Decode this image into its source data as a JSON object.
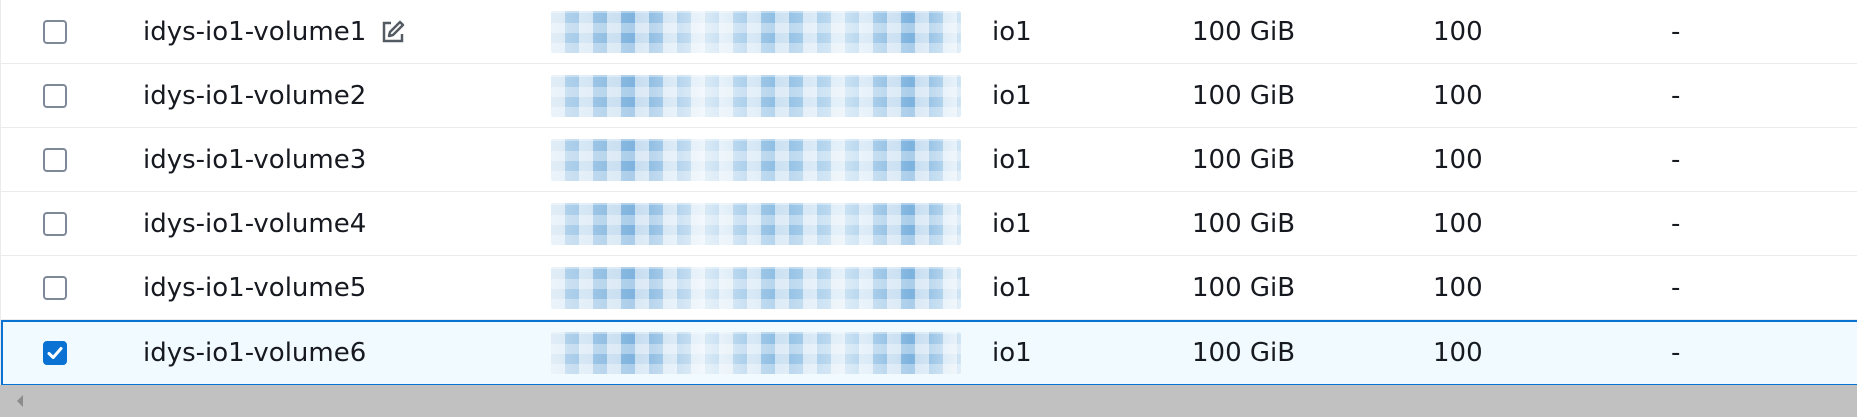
{
  "columns_hidden": true,
  "rows": [
    {
      "name": "idys-io1-volume1",
      "type": "io1",
      "size": "100 GiB",
      "iops": "100",
      "throughput": "-",
      "checked": false,
      "editable": true
    },
    {
      "name": "idys-io1-volume2",
      "type": "io1",
      "size": "100 GiB",
      "iops": "100",
      "throughput": "-",
      "checked": false
    },
    {
      "name": "idys-io1-volume3",
      "type": "io1",
      "size": "100 GiB",
      "iops": "100",
      "throughput": "-",
      "checked": false
    },
    {
      "name": "idys-io1-volume4",
      "type": "io1",
      "size": "100 GiB",
      "iops": "100",
      "throughput": "-",
      "checked": false
    },
    {
      "name": "idys-io1-volume5",
      "type": "io1",
      "size": "100 GiB",
      "iops": "100",
      "throughput": "-",
      "checked": false
    },
    {
      "name": "idys-io1-volume6",
      "type": "io1",
      "size": "100 GiB",
      "iops": "100",
      "throughput": "-",
      "checked": true
    }
  ],
  "colors": {
    "accent": "#0972d3",
    "selected_bg": "#f1faff",
    "border": "#e9ebed",
    "scrollbar": "#c1c1c1"
  },
  "icons": {
    "edit": "edit-icon",
    "check": "checkmark-icon",
    "scroll_left": "scroll-left-arrow-icon"
  }
}
